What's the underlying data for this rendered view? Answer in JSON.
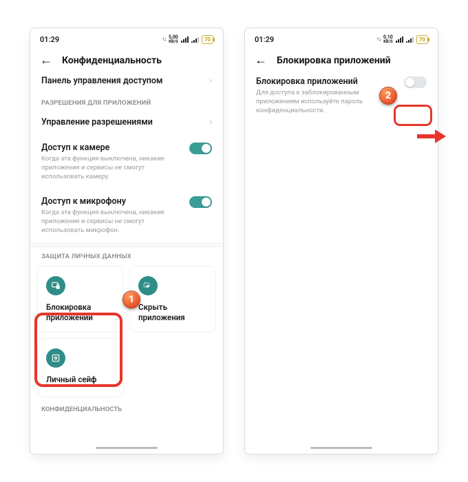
{
  "status": {
    "time": "01:29",
    "speed_left": "5,00",
    "speed_right": "0,10",
    "speed_unit": "KB/S",
    "battery": "70"
  },
  "left": {
    "header_title": "Конфиденциальность",
    "row_access_panel": "Панель управления доступом",
    "section_permissions": "РАЗРЕШЕНИЯ ДЛЯ ПРИЛОЖЕНИЙ",
    "row_manage_perm": "Управление разрешениями",
    "camera": {
      "title": "Доступ к камере",
      "sub": "Когда эта функция выключена, никакие приложения и сервисы не смогут использовать камеру."
    },
    "mic": {
      "title": "Доступ к микрофону",
      "sub": "Когда эта функция выключена, никакие приложения и сервисы не смогут использовать микрофон."
    },
    "section_privacy": "ЗАЩИТА ЛИЧНЫХ ДАННЫХ",
    "card_applock": "Блокировка приложений",
    "card_hide": "Скрыть приложения",
    "card_safe": "Личный сейф",
    "section_conf_trunc": "КОНФИДЕНЦИАЛЬНОСТЬ"
  },
  "right": {
    "header_title": "Блокировка приложений",
    "applock": {
      "title": "Блокировка приложений",
      "sub": "Для доступа к заблокированным приложениям используйте пароль конфиденциальности."
    }
  },
  "callouts": {
    "one": "1",
    "two": "2"
  }
}
